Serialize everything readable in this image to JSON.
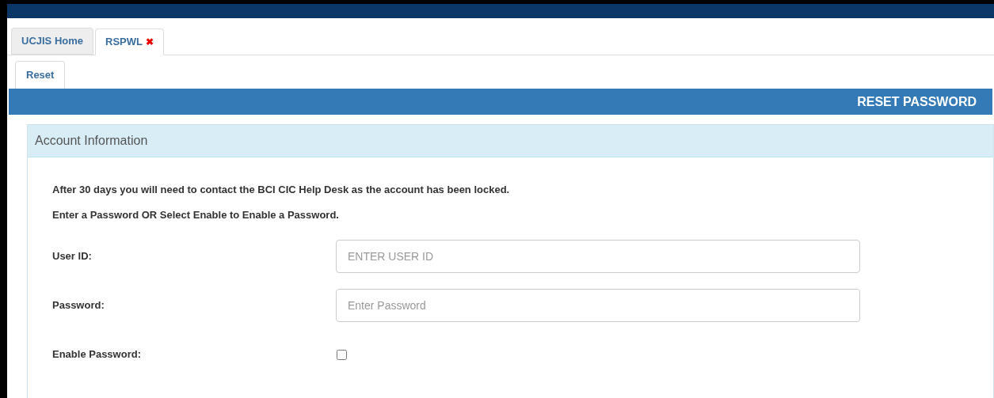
{
  "tabs": [
    {
      "label": "UCJIS Home",
      "selected": false
    },
    {
      "label": "RSPWL",
      "selected": true,
      "close_glyph": "✖"
    }
  ],
  "subtabs": [
    {
      "label": "Reset",
      "selected": true
    }
  ],
  "banner": {
    "title": "RESET PASSWORD"
  },
  "panel": {
    "title": "Account Information",
    "notes": [
      "After 30 days you will need to contact the BCI CIC Help Desk as the account has been locked.",
      "Enter a Password OR Select Enable to Enable a Password."
    ],
    "fields": [
      {
        "kind": "text",
        "label": "User ID:",
        "placeholder": "ENTER USER ID"
      },
      {
        "kind": "text",
        "label": "Password:",
        "placeholder": "Enter Password"
      },
      {
        "kind": "checkbox",
        "label": "Enable Password:",
        "checked": false
      }
    ]
  }
}
